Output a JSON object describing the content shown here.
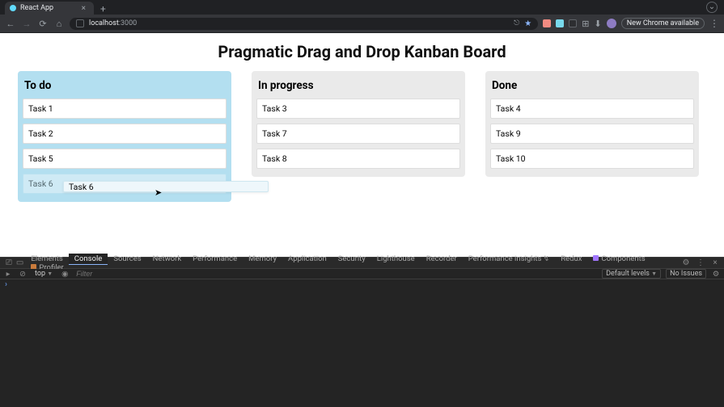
{
  "browser": {
    "tab_title": "React App",
    "url_host": "localhost",
    "url_path": ":3000",
    "chrome_chip": "New Chrome available"
  },
  "page": {
    "title": "Pragmatic Drag and Drop Kanban Board",
    "columns": [
      {
        "title": "To do",
        "cards": [
          "Task 1",
          "Task 2",
          "Task 5",
          "Task 6"
        ],
        "drop_target": true
      },
      {
        "title": "In progress",
        "cards": [
          "Task 3",
          "Task 7",
          "Task 8"
        ],
        "drop_target": false
      },
      {
        "title": "Done",
        "cards": [
          "Task 4",
          "Task 9",
          "Task 10"
        ],
        "drop_target": false
      }
    ],
    "dragging": {
      "label": "Task 6",
      "from_column": 0,
      "card_index": 3
    }
  },
  "devtools": {
    "tabs": [
      "Elements",
      "Console",
      "Sources",
      "Network",
      "Performance",
      "Memory",
      "Application",
      "Security",
      "Lighthouse",
      "Recorder",
      "Performance insights"
    ],
    "active_tab": "Console",
    "extra_tabs": [
      "Redux",
      "Components",
      "Profiler"
    ],
    "context": "top",
    "filter_placeholder": "Filter",
    "levels_label": "Default levels",
    "issues_label": "No Issues"
  }
}
